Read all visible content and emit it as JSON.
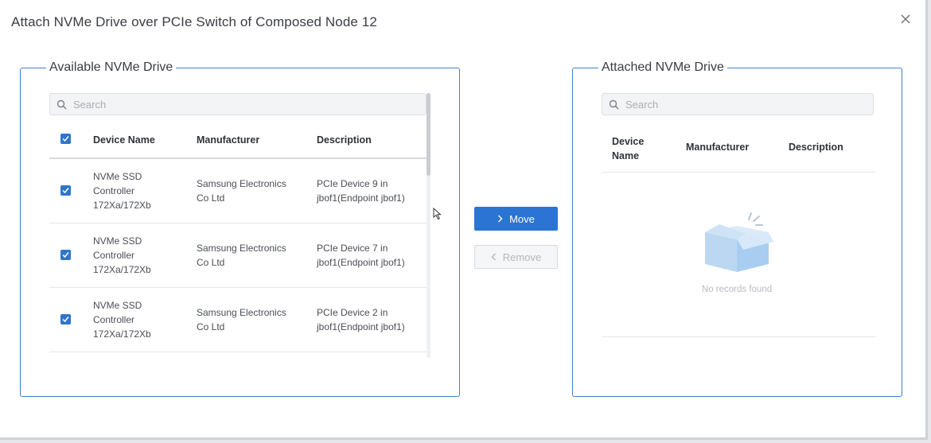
{
  "dialog": {
    "title": "Attach NVMe Drive over PCIe Switch of Composed Node 12",
    "close_icon": "close-icon"
  },
  "available": {
    "legend": "Available NVMe Drive",
    "search_placeholder": "Search",
    "select_all_checked": true,
    "columns": [
      "Device Name",
      "Manufacturer",
      "Description"
    ],
    "rows": [
      {
        "checked": true,
        "device_name": [
          "NVMe SSD",
          "Controller",
          "172Xa/172Xb"
        ],
        "manufacturer": [
          "Samsung Electronics",
          "Co Ltd"
        ],
        "description": [
          "PCIe Device 9 in",
          "jbof1(Endpoint jbof1)"
        ]
      },
      {
        "checked": true,
        "device_name": [
          "NVMe SSD",
          "Controller",
          "172Xa/172Xb"
        ],
        "manufacturer": [
          "Samsung Electronics",
          "Co Ltd"
        ],
        "description": [
          "PCIe Device 7 in",
          "jbof1(Endpoint jbof1)"
        ]
      },
      {
        "checked": true,
        "device_name": [
          "NVMe SSD",
          "Controller",
          "172Xa/172Xb"
        ],
        "manufacturer": [
          "Samsung Electronics",
          "Co Ltd"
        ],
        "description": [
          "PCIe Device 2 in",
          "jbof1(Endpoint jbof1)"
        ]
      }
    ]
  },
  "actions": {
    "move_label": "Move",
    "remove_label": "Remove",
    "move_icon": "chevron-right-icon",
    "remove_icon": "chevron-left-icon"
  },
  "attached": {
    "legend": "Attached NVMe Drive",
    "search_placeholder": "Search",
    "columns": [
      "Device Name",
      "Manufacturer",
      "Description"
    ],
    "device_name_header_lines": [
      "Device",
      "Name"
    ],
    "empty_icon": "empty-box-icon",
    "empty_text": "No records found"
  },
  "colors": {
    "accent": "#2b74d4",
    "panel_border": "#3f7fd0",
    "checkbox": "#2f75cc"
  }
}
